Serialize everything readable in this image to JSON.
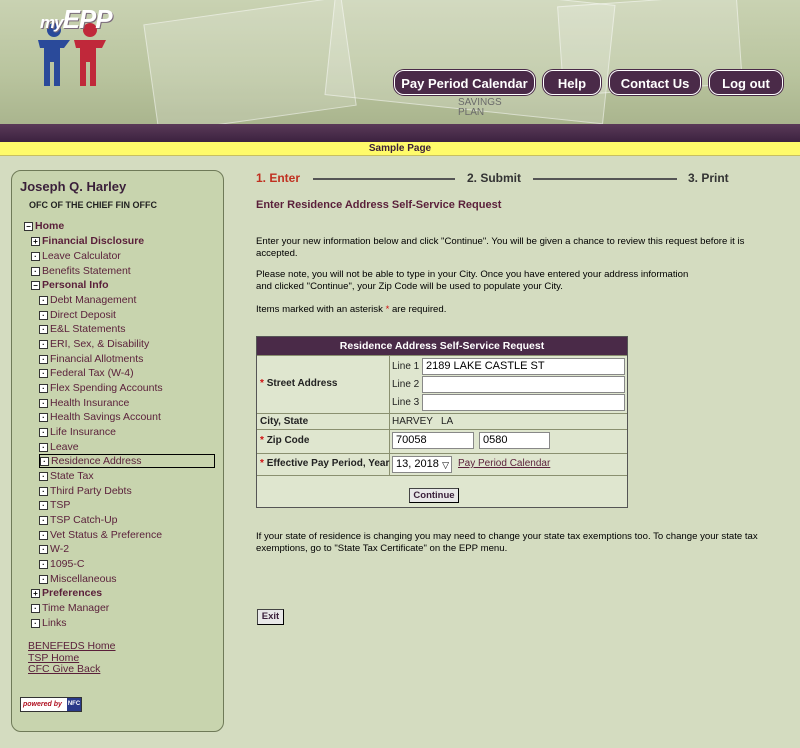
{
  "header": {
    "logo_text": "myEPP",
    "logo_prefix": "my",
    "logo_suffix": "EPP",
    "nav": {
      "pay_period_calendar": "Pay Period Calendar",
      "help": "Help",
      "contact_us": "Contact Us",
      "logout": "Log out"
    },
    "savings_line1": "SAVINGS",
    "savings_line2": "PLAN"
  },
  "banner": "Sample Page",
  "sidebar": {
    "user_name": "Joseph Q. Harley",
    "user_org": "OFC OF THE CHIEF FIN OFFC",
    "tree": {
      "home": "Home",
      "financial_disclosure": "Financial Disclosure",
      "leave_calculator": "Leave Calculator",
      "benefits_statement": "Benefits Statement",
      "personal_info": "Personal Info",
      "debt_management": "Debt Management",
      "direct_deposit": "Direct Deposit",
      "el_statements": "E&L Statements",
      "eri_sex_disability": "ERI, Sex, & Disability",
      "financial_allotments": "Financial Allotments",
      "federal_tax": "Federal Tax (W-4)",
      "flex_spending": "Flex Spending Accounts",
      "health_insurance": "Health Insurance",
      "health_savings": "Health Savings Account",
      "life_insurance": "Life Insurance",
      "leave": "Leave",
      "residence_address": "Residence Address",
      "state_tax": "State Tax",
      "third_party_debts": "Third Party Debts",
      "tsp": "TSP",
      "tsp_catch_up": "TSP Catch-Up",
      "vet_status": "Vet Status & Preference",
      "w2": "W-2",
      "form_1095c": "1095-C",
      "miscellaneous": "Miscellaneous",
      "preferences": "Preferences",
      "time_manager": "Time Manager",
      "links": "Links"
    },
    "links": {
      "benefeds": "BENEFEDS Home",
      "tsp_home": "TSP Home",
      "cfc": "CFC Give Back"
    },
    "powered_by": "powered by",
    "powered_logo": "NFC"
  },
  "steps": {
    "enter": "1. Enter",
    "submit": "2. Submit",
    "print": "3. Print"
  },
  "main": {
    "title": "Enter Residence Address Self-Service Request",
    "para1": "Enter your new information below and click \"Continue\". You will be given a chance to review this request before it is accepted.",
    "para2": "Please note, you will not be able to type in your City. Once you have entered your address information and clicked \"Continue\", your Zip Code will be used to populate your City.",
    "para3_before": "Items marked with an asterisk ",
    "para3_asterisk": "*",
    "para3_after": " are required.",
    "para4": "If your state of residence is changing you may need to change your state tax exemptions too. To change your state tax exemptions, go to \"State Tax Certificate\" on the EPP menu."
  },
  "form": {
    "heading": "Residence Address Self-Service Request",
    "asterisk": "*",
    "street_label": "Street Address",
    "line1_label": "Line 1",
    "line2_label": "Line 2",
    "line3_label": "Line 3",
    "line1_value": "2189 LAKE CASTLE ST",
    "line2_value": "",
    "line3_value": "",
    "city_state_label": "City, State",
    "city_value": "HARVEY",
    "state_value": "LA",
    "zip_label": "Zip Code",
    "zip_value": "70058",
    "zip4_value": "0580",
    "pay_period_label": "Effective Pay Period, Year",
    "pay_period_value": "13, 2018",
    "pay_period_link": "Pay Period Calendar",
    "continue_label": "Continue"
  },
  "exit_label": "Exit"
}
